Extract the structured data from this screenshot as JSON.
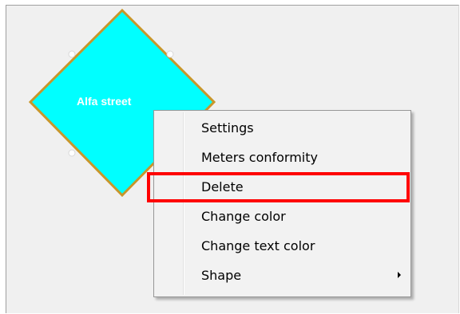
{
  "shape": {
    "label": "Alfa street",
    "fill_color": "#00ffff",
    "border_color": "#c8962a",
    "type": "diamond"
  },
  "context_menu": {
    "items": [
      {
        "label": "Settings"
      },
      {
        "label": "Meters conformity"
      },
      {
        "label": "Delete",
        "highlighted": true
      },
      {
        "label": "Change color"
      },
      {
        "label": "Change text color"
      },
      {
        "label": "Shape",
        "submenu": true
      }
    ]
  },
  "highlight_color": "#ff0000"
}
